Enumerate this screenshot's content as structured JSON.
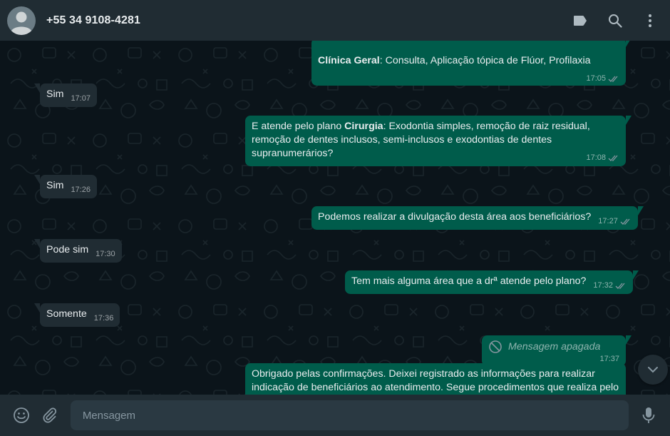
{
  "header": {
    "contact": "+55 34 9108-4281",
    "icons": [
      "label-icon",
      "search-icon",
      "menu-icon"
    ]
  },
  "colors": {
    "header_bg": "#202c33",
    "chat_bg": "#0b141a",
    "incoming_bubble": "#202c33",
    "outgoing_bubble": "#005c4b",
    "read_ticks": "#8696a0"
  },
  "messages": [
    {
      "dir": "out",
      "bold": "Clínica Geral",
      "text": ": Consulta, Aplicação tópica de Flúor, Profilaxia",
      "time": "17:05"
    },
    {
      "dir": "in",
      "text": "Sim",
      "time": "17:07"
    },
    {
      "dir": "out",
      "prefix": "E atende pelo plano ",
      "bold": "Cirurgia",
      "text": ": Exodontia simples, remoção de raiz residual, remoção de dentes inclusos, semi-inclusos e exodontias de dentes supranumerários?",
      "time": "17:08"
    },
    {
      "dir": "in",
      "text": "Sim",
      "time": "17:26"
    },
    {
      "dir": "out",
      "text": "Podemos realizar a divulgação desta área aos beneficiários?",
      "time": "17:27"
    },
    {
      "dir": "in",
      "text": "Pode sim",
      "time": "17:30"
    },
    {
      "dir": "out",
      "text": "Tem mais alguma área que a drª atende pelo plano?",
      "time": "17:32"
    },
    {
      "dir": "in",
      "text": "Somente",
      "time": "17:36"
    },
    {
      "dir": "out",
      "deleted": true,
      "text": "Mensagem apagada",
      "time": "17:37"
    },
    {
      "dir": "out",
      "text": "Obrigado pelas confirmações. Deixei registrado as informações para realizar indicação de beneficiários ao atendimento. Segue procedimentos que realiza pelo"
    }
  ],
  "footer": {
    "placeholder": "Mensagem",
    "icons": [
      "emoji-icon",
      "attach-icon",
      "mic-icon"
    ]
  }
}
